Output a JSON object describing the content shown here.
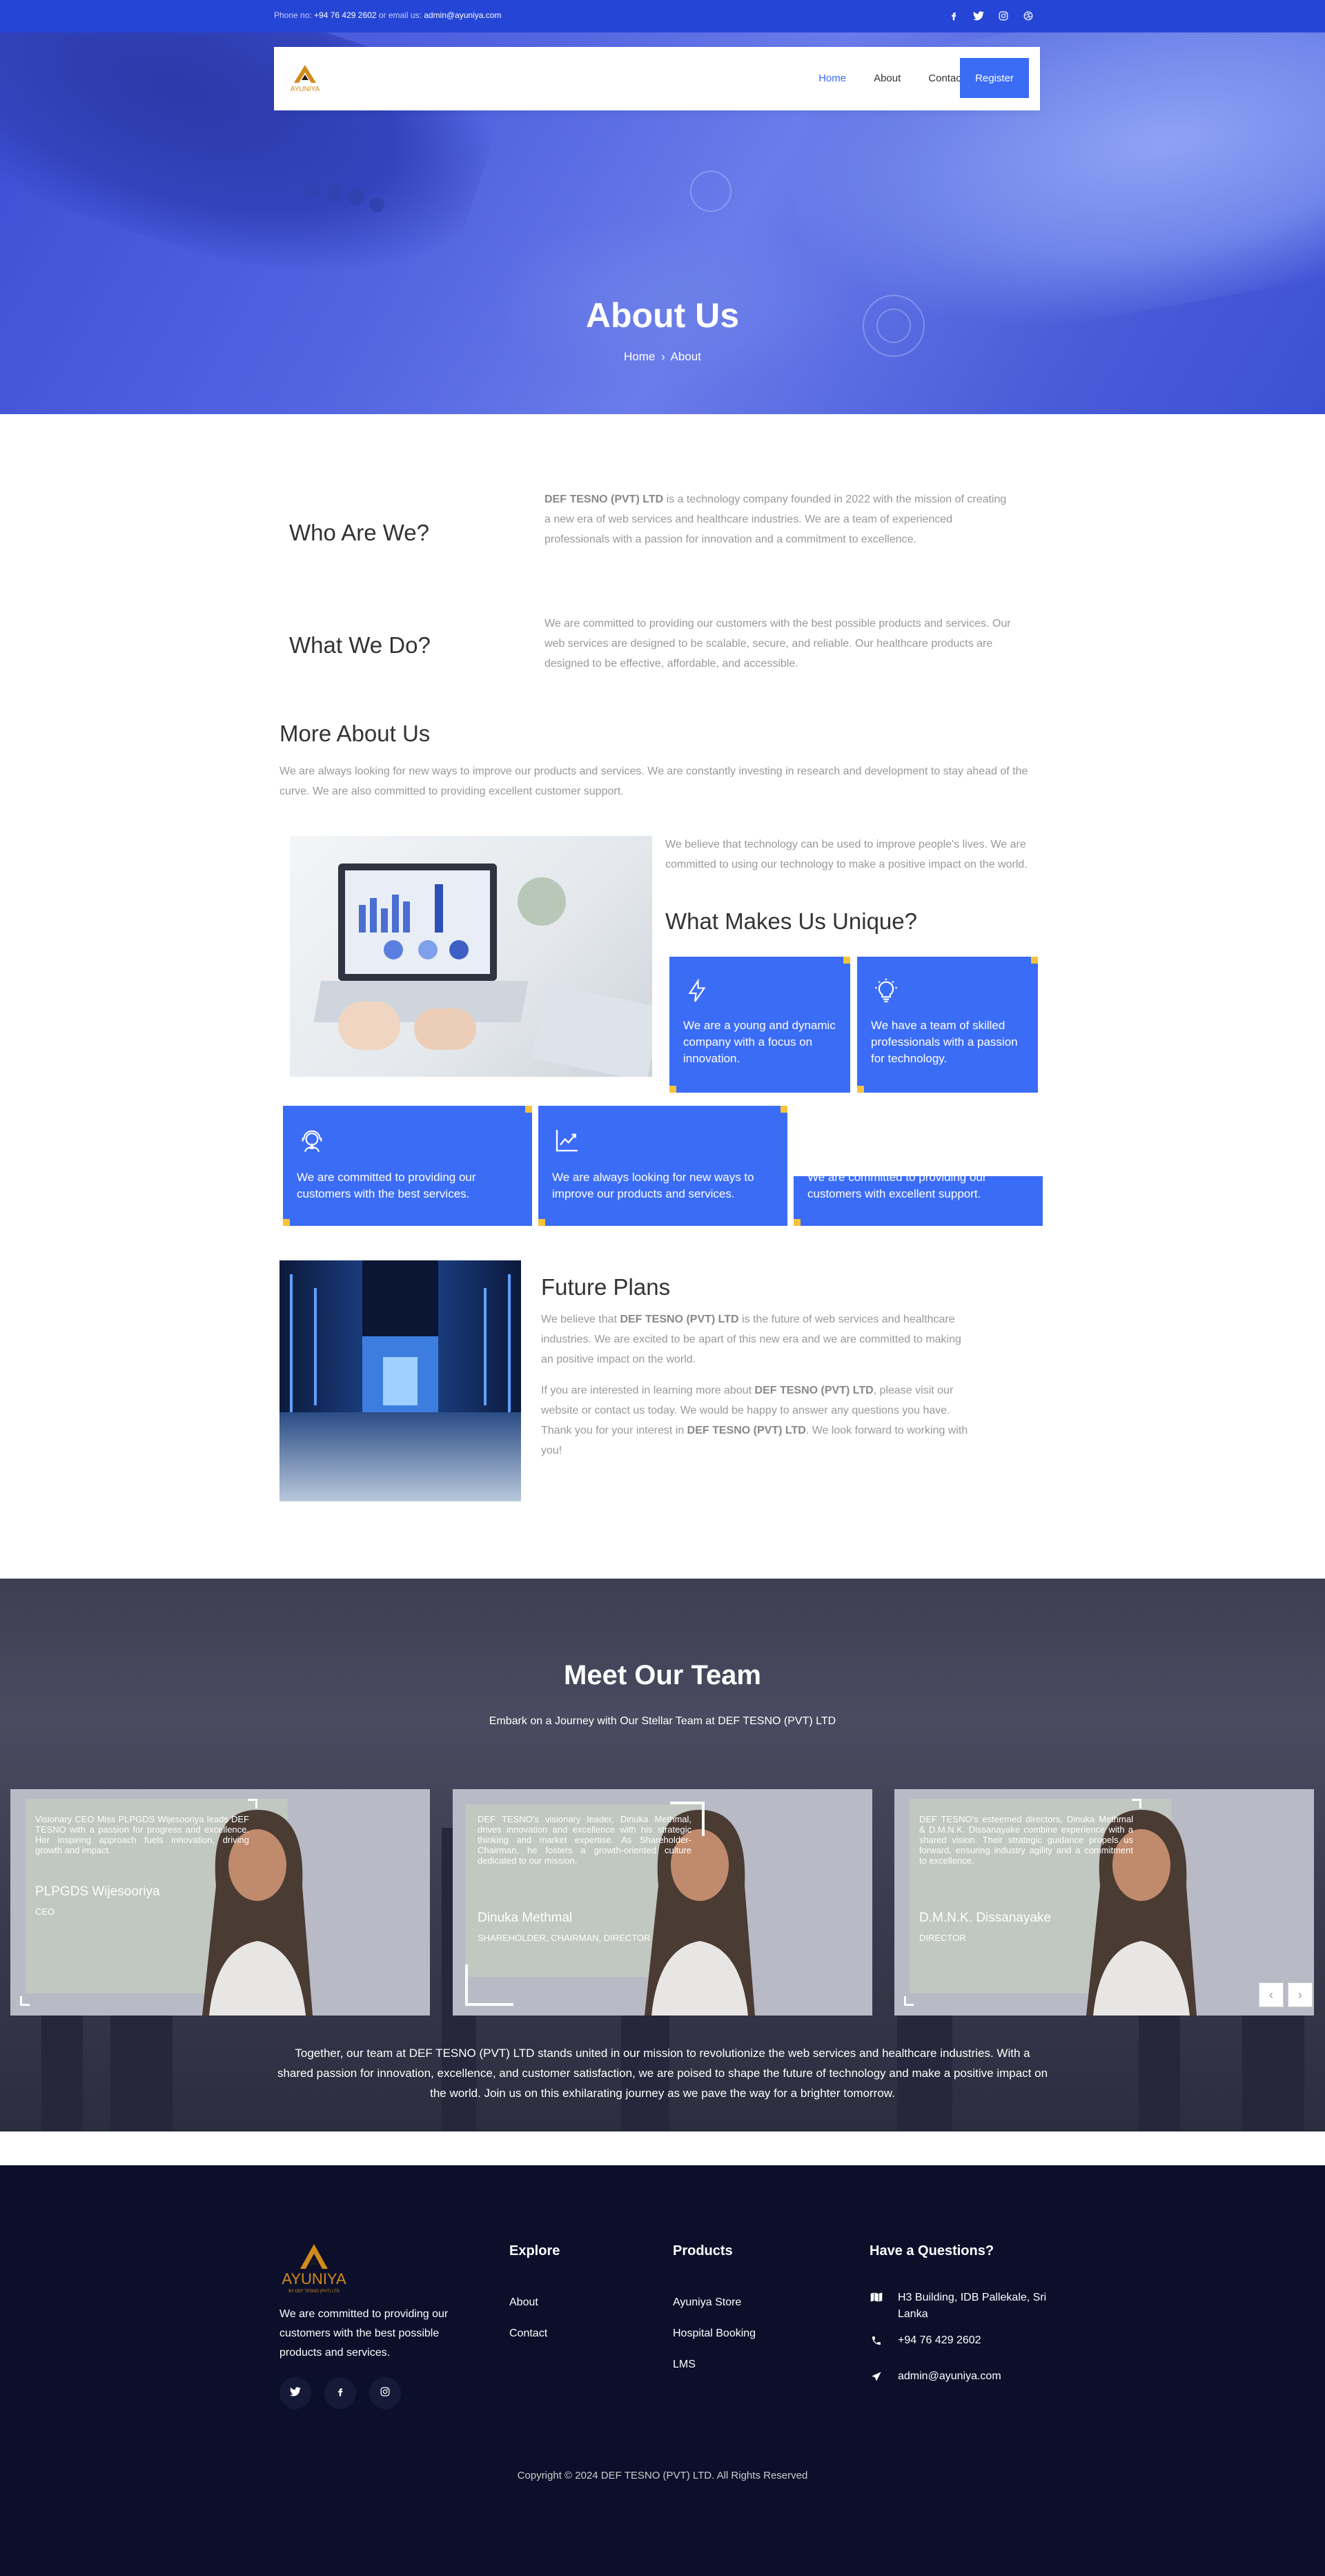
{
  "topbar": {
    "phone_prefix": "Phone no:",
    "phone": "+94 76 429 2602",
    "email_prefix": "or email us:",
    "email": "admin@ayuniya.com",
    "social_icons": [
      "facebook-icon",
      "twitter-icon",
      "instagram-icon",
      "dribbble-icon"
    ]
  },
  "brand": {
    "name": "AYUNIYA",
    "tagline": "BY DEF TESNO (PVT) LTD"
  },
  "nav": {
    "items": [
      "Home",
      "About",
      "Contact us"
    ],
    "active": "Home",
    "register": "Register"
  },
  "hero": {
    "title": "About Us",
    "crumb_home": "Home",
    "crumb_current": "About"
  },
  "who": {
    "heading": "Who Are We?",
    "company": "DEF TESNO (PVT) LTD",
    "text": " is a technology company founded in 2022 with the mission of creating a new era of web services and healthcare industries. We are a team of experienced professionals with a passion for innovation and a commitment to excellence."
  },
  "what": {
    "heading": "What We Do?",
    "text": "We are committed to providing our customers with the best possible products and services. Our web services are designed to be scalable, secure, and reliable. Our healthcare products are designed to be effective, affordable, and accessible."
  },
  "more": {
    "heading": "More About Us",
    "text": "We are always looking for new ways to improve our products and services. We are constantly investing in research and development to stay ahead of the curve. We are also committed to providing excellent customer support.",
    "believe": "We believe that technology can be used to improve people's lives. We are committed to using our technology to make a positive impact on the world."
  },
  "unique": {
    "heading": "What Makes Us Unique?",
    "cards": [
      {
        "icon": "lightning-icon",
        "text": "We are a young and dynamic company with a focus on innovation."
      },
      {
        "icon": "lightbulb-icon",
        "text": "We have a team of skilled professionals with a passion for technology."
      },
      {
        "icon": "support-agent-icon",
        "text": "We are committed to providing our customers with the best services."
      },
      {
        "icon": "growth-chart-icon",
        "text": "We are always looking for new ways to improve our products and services."
      },
      {
        "icon": "",
        "text": "We are committed to providing our customers with excellent support."
      }
    ]
  },
  "future": {
    "heading": "Future Plans",
    "p1_a": "We believe that ",
    "p1_b": "DEF TESNO (PVT) LTD",
    "p1_c": " is the future of web services and healthcare industries. We are excited to be apart of this new era and we are committed to making an positive impact on the world.",
    "p2_a": "If you are interested in learning more about ",
    "p2_b": "DEF TESNO (PVT) LTD",
    "p2_c": ", please visit our website or contact us today. We would be happy to answer any questions you have. Thank you for your interest in ",
    "p2_d": "DEF TESNO (PVT) LTD",
    "p2_e": ". We look forward to working with you!"
  },
  "team": {
    "heading": "Meet Our Team",
    "subtitle": "Embark on a Journey with Our Stellar Team at DEF TESNO (PVT) LTD",
    "members": [
      {
        "desc": "Visionary CEO Miss PLPGDS Wijesooriya leads DEF TESNO with a passion for progress and excellence. Her inspiring approach fuels innovation, driving growth and impact.",
        "name": "PLPGDS Wijesooriya",
        "role": "CEO"
      },
      {
        "desc": "DEF TESNO's visionary leader, Dinuka Methmal, drives innovation and excellence with his strategic thinking and market expertise. As Shareholder-Chairman, he fosters a growth-oriented culture dedicated to our mission.",
        "name": "Dinuka Methmal",
        "role": "SHAREHOLDER, CHAIRMAN, DIRECTOR"
      },
      {
        "desc": "DEF TESNO's esteemed directors, Dinuka Methmal & D.M.N.K. Dissanayake combine experience with a shared vision. Their strategic guidance propels us forward, ensuring industry agility and a commitment to excellence.",
        "name": "D.M.N.K. Dissanayake",
        "role": "DIRECTOR"
      }
    ],
    "prev": "‹",
    "next": "›",
    "outro": "Together, our team at DEF TESNO (PVT) LTD stands united in our mission to revolutionize the web services and healthcare industries. With a shared passion for innovation, excellence, and customer satisfaction, we are poised to shape the future of technology and make a positive impact on the world. Join us on this exhilarating journey as we pave the way for a brighter tomorrow."
  },
  "footer": {
    "about": "We are committed to providing our customers with the best possible products and services.",
    "explore_heading": "Explore",
    "explore": [
      "About",
      "Contact"
    ],
    "products_heading": "Products",
    "products": [
      "Ayuniya Store",
      "Hospital Booking",
      "LMS"
    ],
    "questions_heading": "Have a Questions?",
    "address": "H3 Building, IDB Pallekale, Sri Lanka",
    "phone": "+94 76 429 2602",
    "email": "admin@ayuniya.com",
    "copyright": "Copyright © 2024 DEF TESNO (PVT) LTD. All Rights Reserved"
  }
}
